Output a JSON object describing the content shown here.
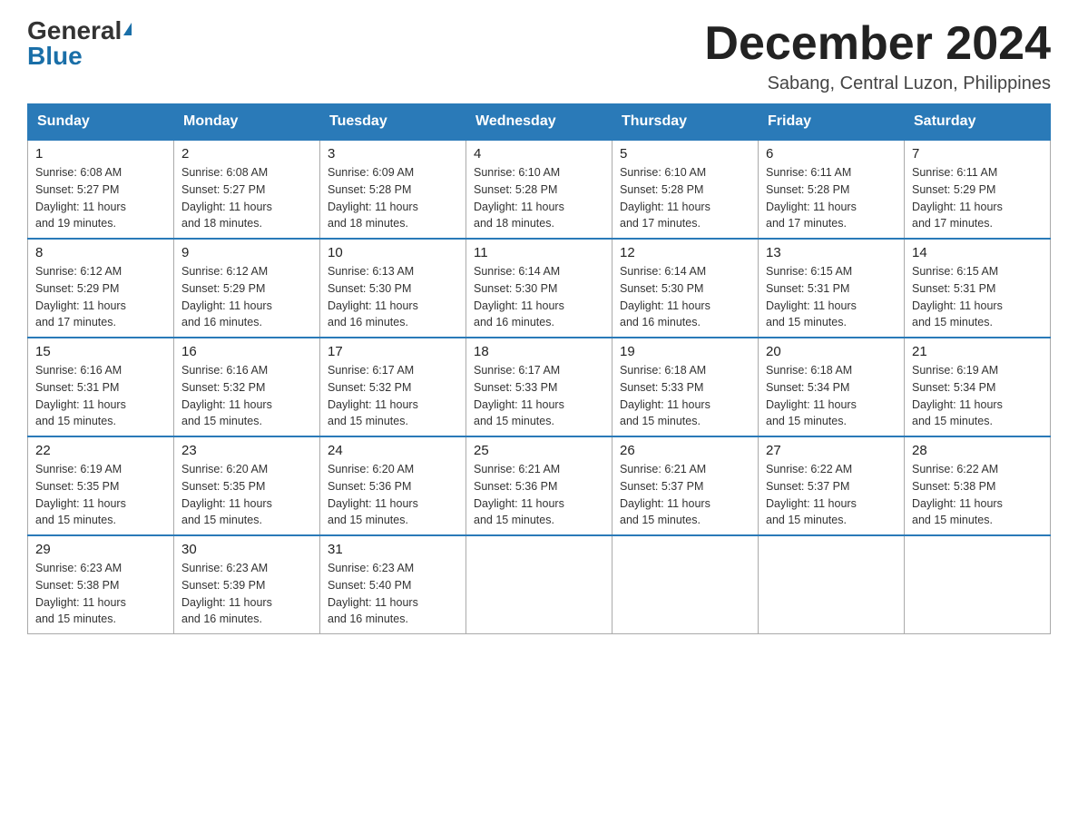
{
  "logo": {
    "general": "General",
    "blue": "Blue"
  },
  "title": "December 2024",
  "location": "Sabang, Central Luzon, Philippines",
  "days_of_week": [
    "Sunday",
    "Monday",
    "Tuesday",
    "Wednesday",
    "Thursday",
    "Friday",
    "Saturday"
  ],
  "weeks": [
    [
      {
        "day": "1",
        "sunrise": "6:08 AM",
        "sunset": "5:27 PM",
        "daylight": "11 hours and 19 minutes."
      },
      {
        "day": "2",
        "sunrise": "6:08 AM",
        "sunset": "5:27 PM",
        "daylight": "11 hours and 18 minutes."
      },
      {
        "day": "3",
        "sunrise": "6:09 AM",
        "sunset": "5:28 PM",
        "daylight": "11 hours and 18 minutes."
      },
      {
        "day": "4",
        "sunrise": "6:10 AM",
        "sunset": "5:28 PM",
        "daylight": "11 hours and 18 minutes."
      },
      {
        "day": "5",
        "sunrise": "6:10 AM",
        "sunset": "5:28 PM",
        "daylight": "11 hours and 17 minutes."
      },
      {
        "day": "6",
        "sunrise": "6:11 AM",
        "sunset": "5:28 PM",
        "daylight": "11 hours and 17 minutes."
      },
      {
        "day": "7",
        "sunrise": "6:11 AM",
        "sunset": "5:29 PM",
        "daylight": "11 hours and 17 minutes."
      }
    ],
    [
      {
        "day": "8",
        "sunrise": "6:12 AM",
        "sunset": "5:29 PM",
        "daylight": "11 hours and 17 minutes."
      },
      {
        "day": "9",
        "sunrise": "6:12 AM",
        "sunset": "5:29 PM",
        "daylight": "11 hours and 16 minutes."
      },
      {
        "day": "10",
        "sunrise": "6:13 AM",
        "sunset": "5:30 PM",
        "daylight": "11 hours and 16 minutes."
      },
      {
        "day": "11",
        "sunrise": "6:14 AM",
        "sunset": "5:30 PM",
        "daylight": "11 hours and 16 minutes."
      },
      {
        "day": "12",
        "sunrise": "6:14 AM",
        "sunset": "5:30 PM",
        "daylight": "11 hours and 16 minutes."
      },
      {
        "day": "13",
        "sunrise": "6:15 AM",
        "sunset": "5:31 PM",
        "daylight": "11 hours and 15 minutes."
      },
      {
        "day": "14",
        "sunrise": "6:15 AM",
        "sunset": "5:31 PM",
        "daylight": "11 hours and 15 minutes."
      }
    ],
    [
      {
        "day": "15",
        "sunrise": "6:16 AM",
        "sunset": "5:31 PM",
        "daylight": "11 hours and 15 minutes."
      },
      {
        "day": "16",
        "sunrise": "6:16 AM",
        "sunset": "5:32 PM",
        "daylight": "11 hours and 15 minutes."
      },
      {
        "day": "17",
        "sunrise": "6:17 AM",
        "sunset": "5:32 PM",
        "daylight": "11 hours and 15 minutes."
      },
      {
        "day": "18",
        "sunrise": "6:17 AM",
        "sunset": "5:33 PM",
        "daylight": "11 hours and 15 minutes."
      },
      {
        "day": "19",
        "sunrise": "6:18 AM",
        "sunset": "5:33 PM",
        "daylight": "11 hours and 15 minutes."
      },
      {
        "day": "20",
        "sunrise": "6:18 AM",
        "sunset": "5:34 PM",
        "daylight": "11 hours and 15 minutes."
      },
      {
        "day": "21",
        "sunrise": "6:19 AM",
        "sunset": "5:34 PM",
        "daylight": "11 hours and 15 minutes."
      }
    ],
    [
      {
        "day": "22",
        "sunrise": "6:19 AM",
        "sunset": "5:35 PM",
        "daylight": "11 hours and 15 minutes."
      },
      {
        "day": "23",
        "sunrise": "6:20 AM",
        "sunset": "5:35 PM",
        "daylight": "11 hours and 15 minutes."
      },
      {
        "day": "24",
        "sunrise": "6:20 AM",
        "sunset": "5:36 PM",
        "daylight": "11 hours and 15 minutes."
      },
      {
        "day": "25",
        "sunrise": "6:21 AM",
        "sunset": "5:36 PM",
        "daylight": "11 hours and 15 minutes."
      },
      {
        "day": "26",
        "sunrise": "6:21 AM",
        "sunset": "5:37 PM",
        "daylight": "11 hours and 15 minutes."
      },
      {
        "day": "27",
        "sunrise": "6:22 AM",
        "sunset": "5:37 PM",
        "daylight": "11 hours and 15 minutes."
      },
      {
        "day": "28",
        "sunrise": "6:22 AM",
        "sunset": "5:38 PM",
        "daylight": "11 hours and 15 minutes."
      }
    ],
    [
      {
        "day": "29",
        "sunrise": "6:23 AM",
        "sunset": "5:38 PM",
        "daylight": "11 hours and 15 minutes."
      },
      {
        "day": "30",
        "sunrise": "6:23 AM",
        "sunset": "5:39 PM",
        "daylight": "11 hours and 16 minutes."
      },
      {
        "day": "31",
        "sunrise": "6:23 AM",
        "sunset": "5:40 PM",
        "daylight": "11 hours and 16 minutes."
      },
      null,
      null,
      null,
      null
    ]
  ],
  "labels": {
    "sunrise": "Sunrise:",
    "sunset": "Sunset:",
    "daylight": "Daylight:"
  }
}
